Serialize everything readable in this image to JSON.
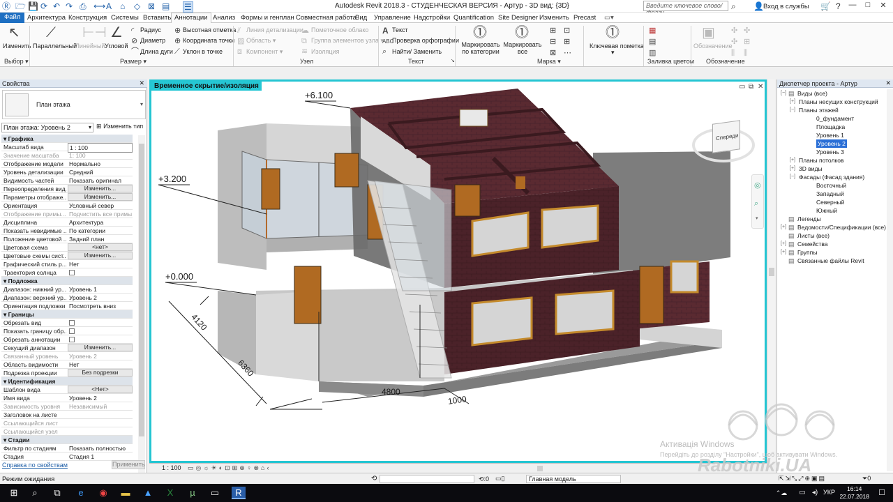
{
  "titlebar": {
    "title": "Autodesk Revit 2018.3 - СТУДЕНЧЕСКАЯ ВЕРСИЯ - Артур - 3D вид: {3D}",
    "search_placeholder": "Введите ключевое слово/фразу",
    "signin": "Вход в службы",
    "min": "—",
    "max": "□",
    "close": "✕"
  },
  "tabs": [
    "Файл",
    "Архитектура",
    "Конструкция",
    "Системы",
    "Вставить",
    "Аннотации",
    "Анализ",
    "Формы и генплан",
    "Совместная работа",
    "Вид",
    "Управление",
    "Надстройки",
    "Quantification",
    "Site Designer",
    "Изменить",
    "Precast"
  ],
  "ribbon": {
    "modify": "Изменить",
    "parallel": "Параллельный",
    "linear": "Линейный",
    "angular": "Угловой",
    "radius": "Радиус",
    "diameter": "Диаметр",
    "arc_length": "Длина дуги",
    "spot_elev": "Высотная отметка",
    "spot_coord": "Координата точки",
    "spot_slope": "Уклон  в точке",
    "detail_line": "Линия детализации",
    "region": "Область",
    "component": "Компонент",
    "revision_cloud": "Пометочное облако",
    "detail_group": "Группа элементов узла",
    "insulation": "Изоляция",
    "text": "Текст",
    "spell": "Проверка  орфографии",
    "find": "Найти/ Заменить",
    "tag_cat": "Маркировать по категории",
    "tag_all": "Маркировать все",
    "keynote": "Ключевая пометка",
    "symbol": "Обозначение",
    "groups": {
      "select": "Выбор",
      "dimension": "Размер",
      "detail": "Узел",
      "text": "Текст",
      "tag": "Марка",
      "color_fill": "Заливка цветом",
      "symbol": "Обозначение"
    }
  },
  "properties": {
    "header": "Свойства",
    "type": "План этажа",
    "selector": "План этажа: Уровень 2",
    "edit_type": "Изменить тип",
    "rows": [
      {
        "k": "Графика",
        "sec": true
      },
      {
        "k": "Масштаб вида",
        "v": "1 : 100",
        "input": true
      },
      {
        "k": "Значение масштаба",
        "v": "1:  100",
        "dim": true
      },
      {
        "k": "Отображение модели",
        "v": "Нормально"
      },
      {
        "k": "Уровень детализации",
        "v": "Средний"
      },
      {
        "k": "Видимость частей",
        "v": "Показать оригинал"
      },
      {
        "k": "Переопределения вид...",
        "v": "Изменить...",
        "btn": true
      },
      {
        "k": "Параметры отображе...",
        "v": "Изменить...",
        "btn": true
      },
      {
        "k": "Ориентация",
        "v": "Условный север"
      },
      {
        "k": "Отображение примы...",
        "v": "Подчистить все примы...",
        "dim": true
      },
      {
        "k": "Дисциплина",
        "v": "Архитектура"
      },
      {
        "k": "Показать невидимые ...",
        "v": "По категории"
      },
      {
        "k": "Положение цветовой ...",
        "v": "Задний план"
      },
      {
        "k": "Цветовая схема",
        "v": "<нет>",
        "btn": true
      },
      {
        "k": "Цветовые схемы сист...",
        "v": "Изменить...",
        "btn": true
      },
      {
        "k": "Графический стиль р...",
        "v": "Нет"
      },
      {
        "k": "Траектория солнца",
        "chk": true
      },
      {
        "k": "Подложка",
        "sec": true
      },
      {
        "k": "Диапазон: нижний ур...",
        "v": "Уровень 1"
      },
      {
        "k": "Диапазон: верхний ур...",
        "v": "Уровень 2"
      },
      {
        "k": "Ориентация подложки",
        "v": "Посмотреть вниз"
      },
      {
        "k": "Границы",
        "sec": true
      },
      {
        "k": "Обрезать вид",
        "chk": true
      },
      {
        "k": "Показать границу обр...",
        "chk": true
      },
      {
        "k": "Обрезать аннотации",
        "chk": true
      },
      {
        "k": "Секущий диапазон",
        "v": "Изменить...",
        "btn": true
      },
      {
        "k": "Связанный уровень",
        "v": "Уровень 2",
        "dim": true
      },
      {
        "k": "Область видимости",
        "v": "Нет"
      },
      {
        "k": "Подрезка проекции",
        "v": "Без подрезки",
        "btn": true
      },
      {
        "k": "Идентификация",
        "sec": true
      },
      {
        "k": "Шаблон вида",
        "v": "<Нет>",
        "btn": true
      },
      {
        "k": "Имя вида",
        "v": "Уровень 2"
      },
      {
        "k": "Зависимость уровня",
        "v": "Независимый",
        "dim": true
      },
      {
        "k": "Заголовок на листе",
        "v": ""
      },
      {
        "k": "Ссылающийся лист",
        "v": "",
        "dim": true
      },
      {
        "k": "Ссылающийся узел",
        "v": "",
        "dim": true
      },
      {
        "k": "Стадии",
        "sec": true
      },
      {
        "k": "Фильтр по стадиям",
        "v": "Показать полностью"
      },
      {
        "k": "Стадия",
        "v": "Стадия 1"
      }
    ],
    "help_link": "Справка по свойствам",
    "apply": "Применить"
  },
  "viewport": {
    "label": "Временное скрытие/изоляция",
    "ctrl_min": "▭",
    "ctrl_restore": "⧉",
    "ctrl_close": "✕",
    "cube_face": "Спереди",
    "elev_top": "+6.100",
    "elev_mid": "+3.200",
    "elev_ground": "+0.000",
    "dim_1": "4120",
    "dim_2": "6360",
    "dim_3": "4800",
    "dim_4": "1000",
    "scale": "1 : 100"
  },
  "browser": {
    "header": "Диспетчер проекта - Артур",
    "items": [
      {
        "t": "Виды (все)",
        "lvl": 0,
        "exp": "−"
      },
      {
        "t": "Планы несущих конструкций",
        "lvl": 1,
        "exp": "+"
      },
      {
        "t": "Планы этажей",
        "lvl": 1,
        "exp": "−"
      },
      {
        "t": "0_фундамент",
        "lvl": 2
      },
      {
        "t": "Площадка",
        "lvl": 2
      },
      {
        "t": "Уровень 1",
        "lvl": 2
      },
      {
        "t": "Уровень 2",
        "lvl": 2,
        "sel": true
      },
      {
        "t": "Уровень 3",
        "lvl": 2
      },
      {
        "t": "Планы потолков",
        "lvl": 1,
        "exp": "+"
      },
      {
        "t": "3D виды",
        "lvl": 1,
        "exp": "+"
      },
      {
        "t": "Фасады (Фасад здания)",
        "lvl": 1,
        "exp": "−"
      },
      {
        "t": "Восточный",
        "lvl": 2
      },
      {
        "t": "Западный",
        "lvl": 2
      },
      {
        "t": "Северный",
        "lvl": 2
      },
      {
        "t": "Южный",
        "lvl": 2
      },
      {
        "t": "Легенды",
        "lvl": 0
      },
      {
        "t": "Ведомости/Спецификации (все)",
        "lvl": 0,
        "exp": "+"
      },
      {
        "t": "Листы (все)",
        "lvl": 0
      },
      {
        "t": "Семейства",
        "lvl": 0,
        "exp": "+"
      },
      {
        "t": "Группы",
        "lvl": 0,
        "exp": "+"
      },
      {
        "t": "Связанные файлы Revit",
        "lvl": 0
      }
    ]
  },
  "status": {
    "text": "Режим ожидания",
    "sel_count": ":0",
    "model": "Главная модель",
    "filter_count": "0"
  },
  "watermark": {
    "activate_title": "Активація Windows",
    "activate_sub": "Перейдіть до розділу \"Настройки\", щоб активувати Windows.",
    "brand": "Rabotniki.UA"
  },
  "taskbar": {
    "lang": "УКР",
    "time": "16:14",
    "date": "22.07.2018"
  }
}
